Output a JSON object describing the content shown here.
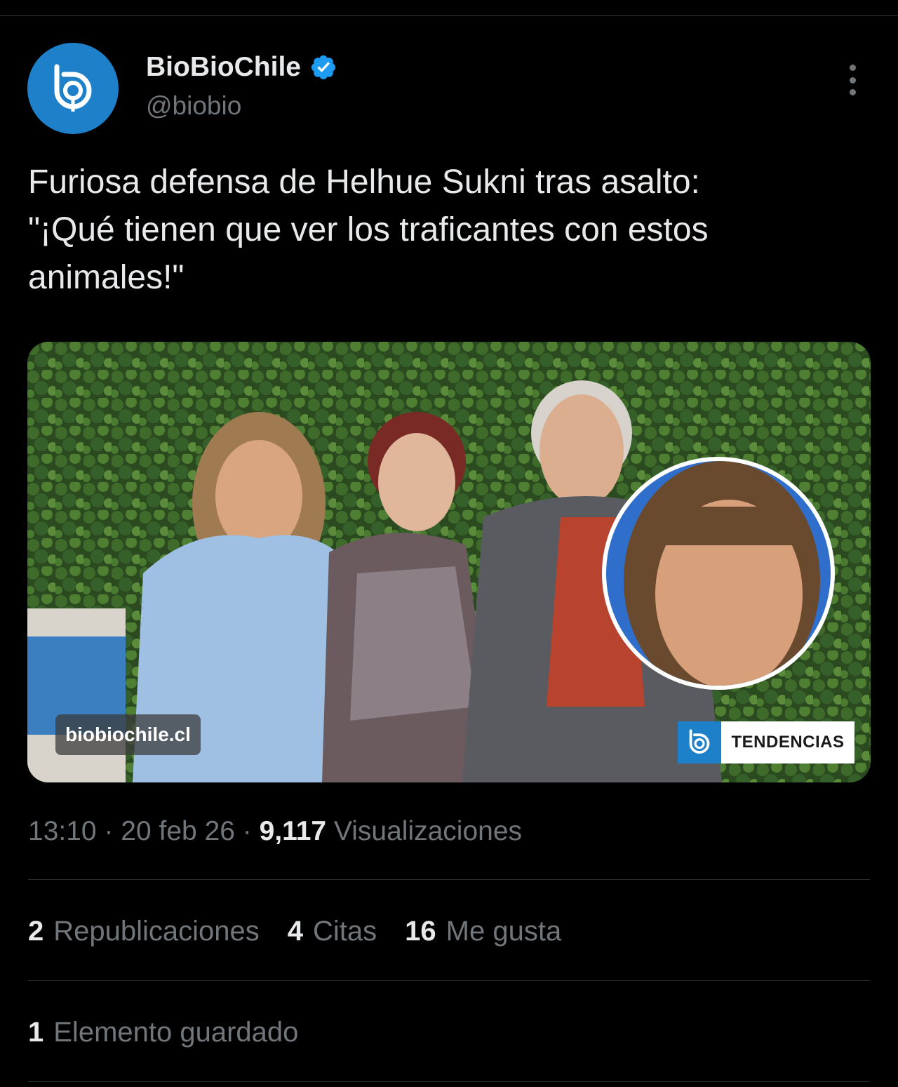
{
  "author": {
    "display_name": "BioBioChile",
    "handle": "@biobio",
    "verified": true,
    "avatar_icon": "biobio-logo-icon",
    "brand_color": "#1e80c9",
    "verified_color": "#1d9bf0"
  },
  "tweet": {
    "text_lines": [
      "Furiosa defensa de Helhue Sukni tras asalto:",
      "\"¡Qué tienen que ver los traficantes con estos",
      "animales!\""
    ]
  },
  "media": {
    "watermark": "biobiochile.cl",
    "badge_label": "TENDENCIAS",
    "badge_icon": "biobio-logo-icon"
  },
  "meta": {
    "time": "13:10",
    "date": "20 feb 26",
    "separator": "·",
    "views_count": "9,117",
    "views_label": "Visualizaciones"
  },
  "stats": {
    "reposts_count": "2",
    "reposts_label": "Republicaciones",
    "quotes_count": "4",
    "quotes_label": "Citas",
    "likes_count": "16",
    "likes_label": "Me gusta",
    "bookmarks_count": "1",
    "bookmarks_label": "Elemento guardado"
  },
  "more_icon": "more-vertical-icon"
}
